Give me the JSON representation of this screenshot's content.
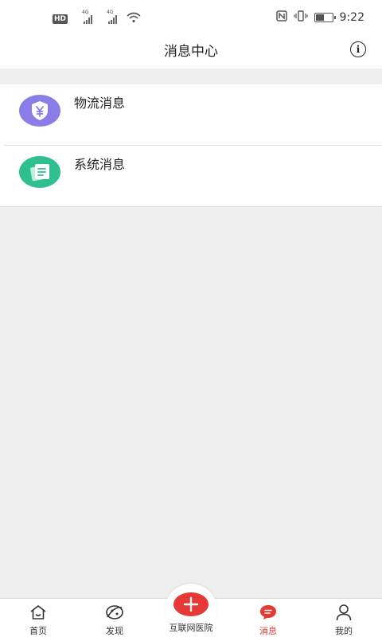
{
  "status_bar": {
    "hd": "HD",
    "sim1": "4G",
    "sim2": "4G",
    "time": "9:22"
  },
  "header": {
    "title": "消息中心",
    "info_glyph": "i"
  },
  "messages": [
    {
      "label": "物流消息",
      "icon": "shield-yen-icon",
      "color": "#8b7de8"
    },
    {
      "label": "系统消息",
      "icon": "document-icon",
      "color": "#2fc08f"
    }
  ],
  "bottom_nav": {
    "items": [
      {
        "label": "首页",
        "icon": "home-icon"
      },
      {
        "label": "发现",
        "icon": "discover-icon"
      },
      {
        "label": "互联网医院",
        "icon": "plus-icon"
      },
      {
        "label": "消息",
        "icon": "message-icon"
      },
      {
        "label": "我的",
        "icon": "user-icon"
      }
    ],
    "active": "消息",
    "active_color": "#e53935"
  }
}
